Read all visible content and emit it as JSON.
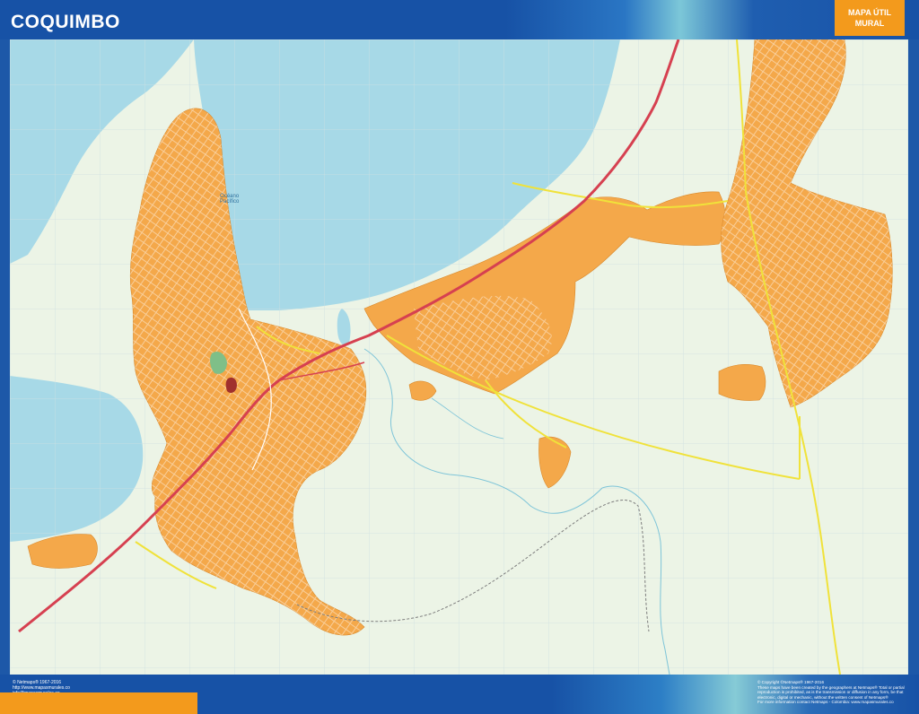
{
  "header": {
    "title": "COQUIMBO",
    "brand_line1": "MAPA ÚTIL",
    "brand_line2": "MURAL"
  },
  "map": {
    "ocean_label_1": "Océano",
    "ocean_label_2": "Pacífico",
    "colors": {
      "water": "#a7d9e7",
      "land": "#ecf4e6",
      "urban": "#f4a84a",
      "major_road": "#f0e23a",
      "highway": "#d64050",
      "park": "#7fbf88",
      "landmark": "#a0302d"
    }
  },
  "footer": {
    "left_line1": "© Netmaps® 1967-2016",
    "left_line2": "http://www.mapasmurales.co",
    "left_line3": "info@mapasmurales.co",
    "right_line1": "© Copyright ©Netmaps® 1967-2016",
    "right_line2": "These maps have been created by the geographers at Netmaps® Total or partial",
    "right_line3": "reproduction is prohibited, as is the transmission or diffusion in any form, be that",
    "right_line4": "electronic, digital or mechanic, without the written consent of Netmaps®",
    "right_line5": "For more information contact Netmaps - Colombia: www.mapasmurales.co"
  }
}
